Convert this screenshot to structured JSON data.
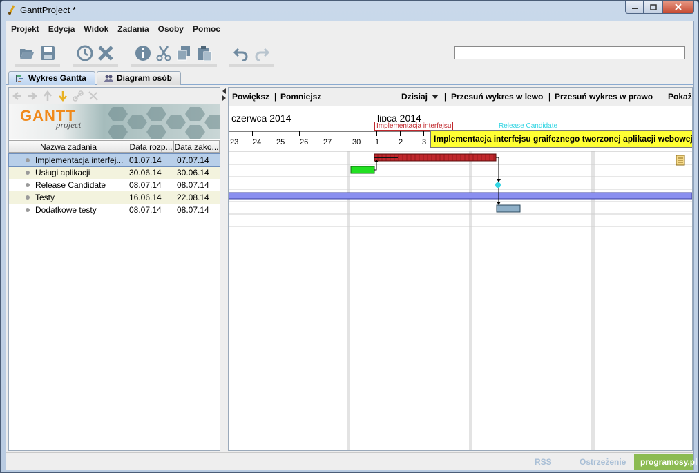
{
  "window": {
    "title": "GanttProject *"
  },
  "menu": [
    "Projekt",
    "Edycja",
    "Widok",
    "Zadania",
    "Osoby",
    "Pomoc"
  ],
  "toolbar": {
    "icons": [
      "open-folder-icon",
      "save-icon",
      "history-clock-icon",
      "delete-x-icon",
      "info-icon",
      "cut-icon",
      "copy-icon",
      "paste-icon",
      "undo-icon",
      "redo-icon"
    ],
    "search_value": ""
  },
  "tabs": [
    {
      "label": "Wykres Gantta",
      "active": true
    },
    {
      "label": "Diagram osób",
      "active": false
    }
  ],
  "logo": {
    "main": "GANTT",
    "sub": "project"
  },
  "table": {
    "headers": [
      "Nazwa zadania",
      "Data rozp...",
      "Data zako..."
    ],
    "rows": [
      {
        "name": "Implementacja interfej...",
        "start": "01.07.14",
        "end": "07.07.14"
      },
      {
        "name": "Usługi aplikacji",
        "start": "30.06.14",
        "end": "30.06.14"
      },
      {
        "name": "Release Candidate",
        "start": "08.07.14",
        "end": "08.07.14"
      },
      {
        "name": "Testy",
        "start": "16.06.14",
        "end": "22.08.14"
      },
      {
        "name": "Dodatkowe testy",
        "start": "08.07.14",
        "end": "08.07.14"
      }
    ]
  },
  "chart_toolbar": {
    "zoom_in": "Powiększ",
    "sep1": "|",
    "zoom_out": "Pomniejsz",
    "today": "Dzisiaj",
    "sep2": "|",
    "scroll_left": "Przesuń wykres w lewo",
    "sep3": "|",
    "scroll_right": "Przesuń wykres w prawo",
    "show": "Pokaż"
  },
  "timeline": {
    "months": [
      "czerwca 2014",
      "lipca 2014"
    ],
    "days": [
      "23",
      "24",
      "25",
      "26",
      "27",
      "30",
      "1",
      "2",
      "3"
    ],
    "marker_labels": [
      "Implementacja interfejsu",
      "Release Candidate"
    ]
  },
  "tooltip": "Implementacja interfejsu graifcznego tworzonej aplikacji webowej",
  "status": {
    "rss": "RSS",
    "warning": "Ostrzeżenie",
    "site": "programosy.pl"
  },
  "colors": {
    "task_impl": "#c0282d",
    "task_service": "#22e022",
    "milestone": "#33d5e3",
    "task_testy": "#8a8ff0",
    "task_extra": "#8eafc7",
    "tooltip_bg": "#ffff33"
  }
}
